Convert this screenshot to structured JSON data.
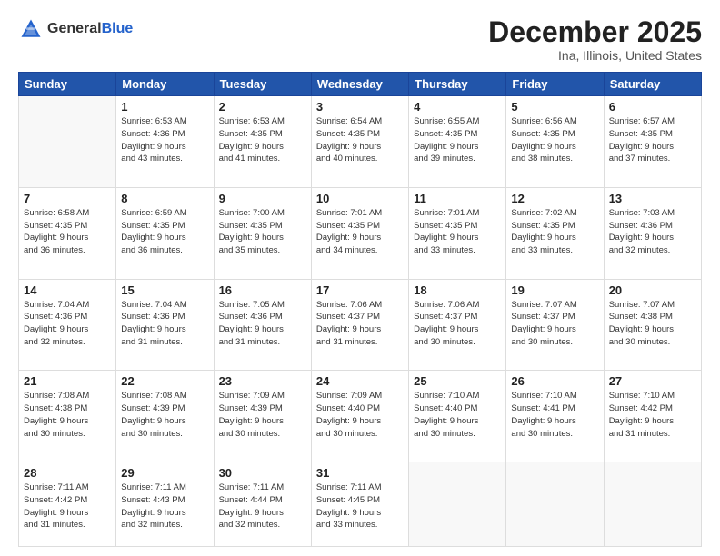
{
  "header": {
    "logo_general": "General",
    "logo_blue": "Blue",
    "month": "December 2025",
    "location": "Ina, Illinois, United States"
  },
  "days_of_week": [
    "Sunday",
    "Monday",
    "Tuesday",
    "Wednesday",
    "Thursday",
    "Friday",
    "Saturday"
  ],
  "weeks": [
    [
      {
        "day": "",
        "info": ""
      },
      {
        "day": "1",
        "info": "Sunrise: 6:53 AM\nSunset: 4:36 PM\nDaylight: 9 hours\nand 43 minutes."
      },
      {
        "day": "2",
        "info": "Sunrise: 6:53 AM\nSunset: 4:35 PM\nDaylight: 9 hours\nand 41 minutes."
      },
      {
        "day": "3",
        "info": "Sunrise: 6:54 AM\nSunset: 4:35 PM\nDaylight: 9 hours\nand 40 minutes."
      },
      {
        "day": "4",
        "info": "Sunrise: 6:55 AM\nSunset: 4:35 PM\nDaylight: 9 hours\nand 39 minutes."
      },
      {
        "day": "5",
        "info": "Sunrise: 6:56 AM\nSunset: 4:35 PM\nDaylight: 9 hours\nand 38 minutes."
      },
      {
        "day": "6",
        "info": "Sunrise: 6:57 AM\nSunset: 4:35 PM\nDaylight: 9 hours\nand 37 minutes."
      }
    ],
    [
      {
        "day": "7",
        "info": "Sunrise: 6:58 AM\nSunset: 4:35 PM\nDaylight: 9 hours\nand 36 minutes."
      },
      {
        "day": "8",
        "info": "Sunrise: 6:59 AM\nSunset: 4:35 PM\nDaylight: 9 hours\nand 36 minutes."
      },
      {
        "day": "9",
        "info": "Sunrise: 7:00 AM\nSunset: 4:35 PM\nDaylight: 9 hours\nand 35 minutes."
      },
      {
        "day": "10",
        "info": "Sunrise: 7:01 AM\nSunset: 4:35 PM\nDaylight: 9 hours\nand 34 minutes."
      },
      {
        "day": "11",
        "info": "Sunrise: 7:01 AM\nSunset: 4:35 PM\nDaylight: 9 hours\nand 33 minutes."
      },
      {
        "day": "12",
        "info": "Sunrise: 7:02 AM\nSunset: 4:35 PM\nDaylight: 9 hours\nand 33 minutes."
      },
      {
        "day": "13",
        "info": "Sunrise: 7:03 AM\nSunset: 4:36 PM\nDaylight: 9 hours\nand 32 minutes."
      }
    ],
    [
      {
        "day": "14",
        "info": "Sunrise: 7:04 AM\nSunset: 4:36 PM\nDaylight: 9 hours\nand 32 minutes."
      },
      {
        "day": "15",
        "info": "Sunrise: 7:04 AM\nSunset: 4:36 PM\nDaylight: 9 hours\nand 31 minutes."
      },
      {
        "day": "16",
        "info": "Sunrise: 7:05 AM\nSunset: 4:36 PM\nDaylight: 9 hours\nand 31 minutes."
      },
      {
        "day": "17",
        "info": "Sunrise: 7:06 AM\nSunset: 4:37 PM\nDaylight: 9 hours\nand 31 minutes."
      },
      {
        "day": "18",
        "info": "Sunrise: 7:06 AM\nSunset: 4:37 PM\nDaylight: 9 hours\nand 30 minutes."
      },
      {
        "day": "19",
        "info": "Sunrise: 7:07 AM\nSunset: 4:37 PM\nDaylight: 9 hours\nand 30 minutes."
      },
      {
        "day": "20",
        "info": "Sunrise: 7:07 AM\nSunset: 4:38 PM\nDaylight: 9 hours\nand 30 minutes."
      }
    ],
    [
      {
        "day": "21",
        "info": "Sunrise: 7:08 AM\nSunset: 4:38 PM\nDaylight: 9 hours\nand 30 minutes."
      },
      {
        "day": "22",
        "info": "Sunrise: 7:08 AM\nSunset: 4:39 PM\nDaylight: 9 hours\nand 30 minutes."
      },
      {
        "day": "23",
        "info": "Sunrise: 7:09 AM\nSunset: 4:39 PM\nDaylight: 9 hours\nand 30 minutes."
      },
      {
        "day": "24",
        "info": "Sunrise: 7:09 AM\nSunset: 4:40 PM\nDaylight: 9 hours\nand 30 minutes."
      },
      {
        "day": "25",
        "info": "Sunrise: 7:10 AM\nSunset: 4:40 PM\nDaylight: 9 hours\nand 30 minutes."
      },
      {
        "day": "26",
        "info": "Sunrise: 7:10 AM\nSunset: 4:41 PM\nDaylight: 9 hours\nand 30 minutes."
      },
      {
        "day": "27",
        "info": "Sunrise: 7:10 AM\nSunset: 4:42 PM\nDaylight: 9 hours\nand 31 minutes."
      }
    ],
    [
      {
        "day": "28",
        "info": "Sunrise: 7:11 AM\nSunset: 4:42 PM\nDaylight: 9 hours\nand 31 minutes."
      },
      {
        "day": "29",
        "info": "Sunrise: 7:11 AM\nSunset: 4:43 PM\nDaylight: 9 hours\nand 32 minutes."
      },
      {
        "day": "30",
        "info": "Sunrise: 7:11 AM\nSunset: 4:44 PM\nDaylight: 9 hours\nand 32 minutes."
      },
      {
        "day": "31",
        "info": "Sunrise: 7:11 AM\nSunset: 4:45 PM\nDaylight: 9 hours\nand 33 minutes."
      },
      {
        "day": "",
        "info": ""
      },
      {
        "day": "",
        "info": ""
      },
      {
        "day": "",
        "info": ""
      }
    ]
  ]
}
